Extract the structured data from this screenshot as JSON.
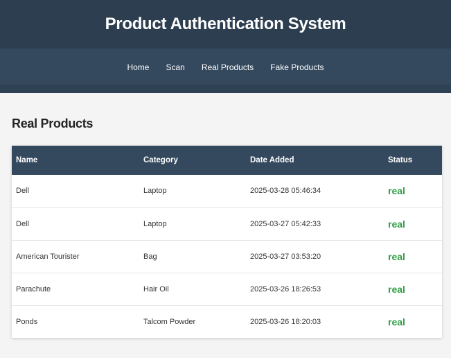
{
  "header": {
    "title": "Product Authentication System"
  },
  "nav": {
    "items": [
      "Home",
      "Scan",
      "Real Products",
      "Fake Products"
    ]
  },
  "main": {
    "title": "Real Products",
    "table": {
      "columns": [
        "Name",
        "Category",
        "Date Added",
        "Status"
      ],
      "rows": [
        [
          "Dell",
          "Laptop",
          "2025-03-28 05:46:34",
          "real"
        ],
        [
          "Dell",
          "Laptop",
          "2025-03-27 05:42:33",
          "real"
        ],
        [
          "American Tourister",
          "Bag",
          "2025-03-27 03:53:20",
          "real"
        ],
        [
          "Parachute",
          "Hair Oil",
          "2025-03-26 18:26:53",
          "real"
        ],
        [
          "Ponds",
          "Talcom Powder",
          "2025-03-26 18:20:03",
          "real"
        ]
      ]
    }
  },
  "colors": {
    "header_bg": "#2c3e50",
    "nav_bg": "#34495e",
    "status_real": "#2f9e44",
    "page_bg": "#f4f4f4"
  }
}
